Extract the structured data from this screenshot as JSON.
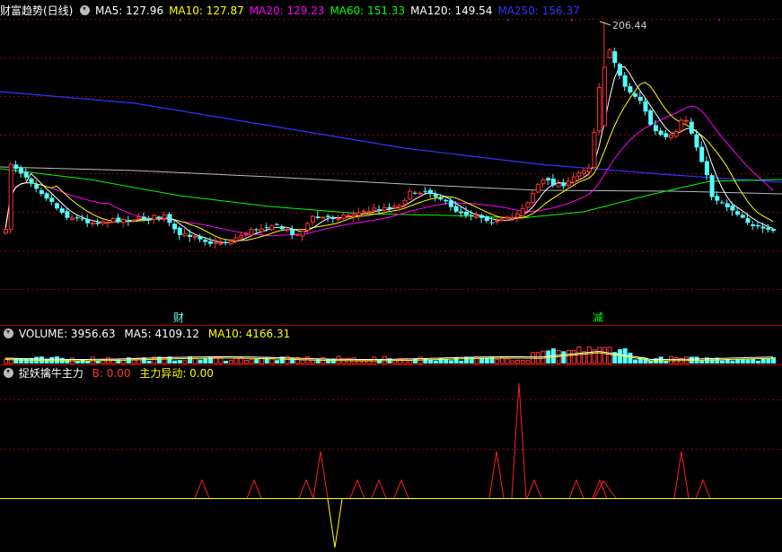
{
  "main_panel": {
    "title": "财富趋势(日线)",
    "ma_legend": [
      {
        "label": "MA5: 127.96",
        "color": "#ffffff"
      },
      {
        "label": "MA10: 127.87",
        "color": "#ffff00"
      },
      {
        "label": "MA20: 129.23",
        "color": "#ff00ff"
      },
      {
        "label": "MA60: 151.33",
        "color": "#00ff00"
      },
      {
        "label": "MA120: 149.54",
        "color": "#ffffff"
      },
      {
        "label": "MA250: 156.37",
        "color": "#3333ff"
      }
    ],
    "high_label": "206.44",
    "signal_buy": "财",
    "signal_sell": "减"
  },
  "volume_panel": {
    "label": "VOLUME: 3956.63",
    "ma5": "MA5: 4109.12",
    "ma10": "MA10: 4166.31"
  },
  "indicator_panel": {
    "title": "捉妖擒牛主力",
    "b_label": "B: 0.00",
    "main_label": "主力异动: 0.00"
  },
  "colors": {
    "up": "#ff3333",
    "down": "#54ffff",
    "grid": "#8b0000",
    "background": "#000000"
  }
}
